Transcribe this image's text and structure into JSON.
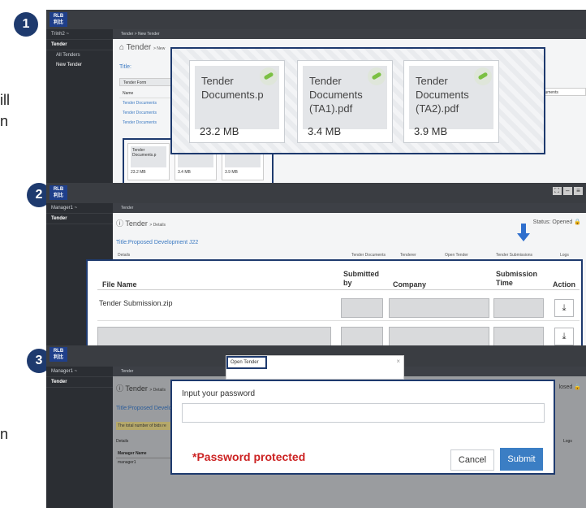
{
  "steps": [
    "1",
    "2",
    "3"
  ],
  "side_fragments": [
    "ill",
    "n",
    "n"
  ],
  "logo": {
    "line1": "RLB",
    "line2": "利比"
  },
  "panel1": {
    "user": "Trinh2 ~",
    "sidebar": [
      "Tender",
      "All Tenders",
      "New Tender"
    ],
    "breadcrumb": "Tender > New Tender",
    "header": "Tender",
    "header_sub": "> New",
    "title_label": "Title:",
    "tab_label": "Tender Form",
    "list_header": "Name",
    "list_items": [
      "Tender Documents",
      "Tender Documents",
      "Tender Documents"
    ],
    "right_tab": "... Documents",
    "mini_cards": [
      {
        "name": "Tender Documents.p",
        "size": "23.2 MB"
      },
      {
        "name": "(TA1).pdf",
        "size": "3.4 MB"
      },
      {
        "name": "(TA2).pdf",
        "size": "3.9 MB"
      }
    ],
    "zoom_cards": [
      {
        "line1": "Tender",
        "line2": "Documents.p",
        "line3": "",
        "size": "23.2 MB"
      },
      {
        "line1": "Tender",
        "line2": "Documents",
        "line3": "(TA1).pdf",
        "size": "3.4 MB"
      },
      {
        "line1": "Tender",
        "line2": "Documents",
        "line3": "(TA2).pdf",
        "size": "3.9 MB"
      }
    ]
  },
  "panel2": {
    "user": "Manager1 ~",
    "sidebar": [
      "Tender"
    ],
    "breadcrumb": "Tender",
    "header": "Tender",
    "header_sub": "> Details",
    "status": "Status: Opened",
    "title": "Title:Proposed Development J22",
    "tabs": [
      "Details",
      "Tender Documents",
      "Tenderer",
      "Open Tender",
      "Tender Submissions",
      "Logs"
    ],
    "table_headers": [
      "File Name",
      "Submitted by",
      "Company",
      "Submission Time",
      "Action"
    ],
    "rows": [
      {
        "file": "Tender Submission.zip"
      },
      {
        "file": ""
      }
    ]
  },
  "panel3": {
    "user": "Manager1 ~",
    "sidebar": [
      "Tender"
    ],
    "breadcrumb": "Tender",
    "header": "Tender",
    "header_sub": "> Details",
    "status_fragment": "losed",
    "title_fragment": "Title:Proposed Develo",
    "notice": "The total number of bids re",
    "details_label": "Details",
    "manager_header": "Manager Name",
    "manager_row": "manager1",
    "logs_fragment": "Logs",
    "modal_title": "Open Tender",
    "password_label": "Input your password",
    "password_value": "",
    "protected_note": "*Password protected",
    "cancel": "Cancel",
    "submit": "Submit"
  },
  "colors": {
    "accent": "#3b7ec4",
    "navy": "#1e3a6e",
    "warning": "#cc2222"
  }
}
